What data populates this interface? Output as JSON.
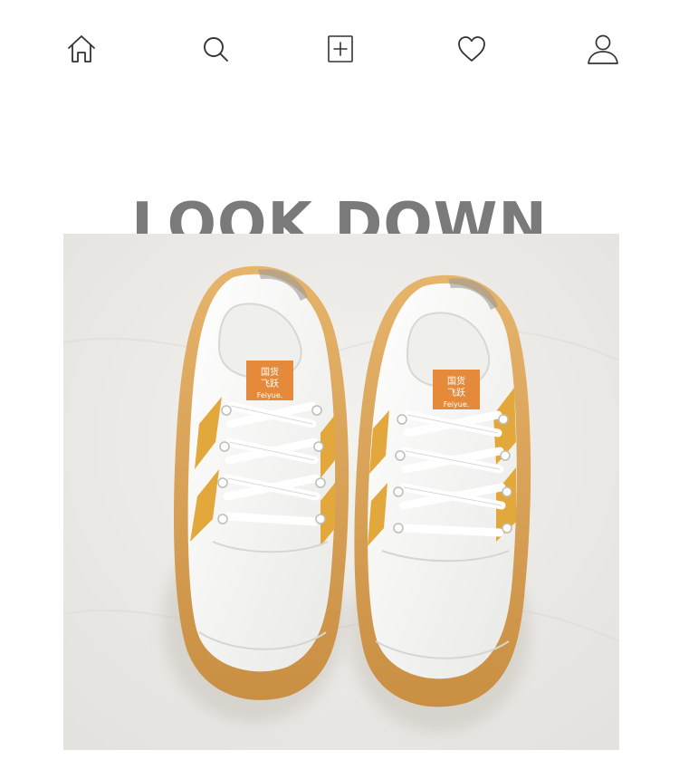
{
  "nav": {
    "items": [
      {
        "icon": "home-icon"
      },
      {
        "icon": "search-icon"
      },
      {
        "icon": "add-square-icon"
      },
      {
        "icon": "heart-icon"
      },
      {
        "icon": "user-icon"
      }
    ],
    "icon_color": "#333333"
  },
  "headline": {
    "text": "LOOK DOWN",
    "color": "#7a7a7a"
  },
  "product": {
    "image_subject": "pair of white canvas sneakers with gum soles and orange stripes, viewed from above",
    "tag_text_line1": "国货",
    "tag_text_line2": "飞跃",
    "tag_brand": "Feiyue.",
    "colors": {
      "backdrop": "#ecebe8",
      "canvas": "#f7f7f5",
      "sole": "#d9a35a",
      "stripe": "#e3a83c",
      "tag": "#e58a3a"
    }
  }
}
